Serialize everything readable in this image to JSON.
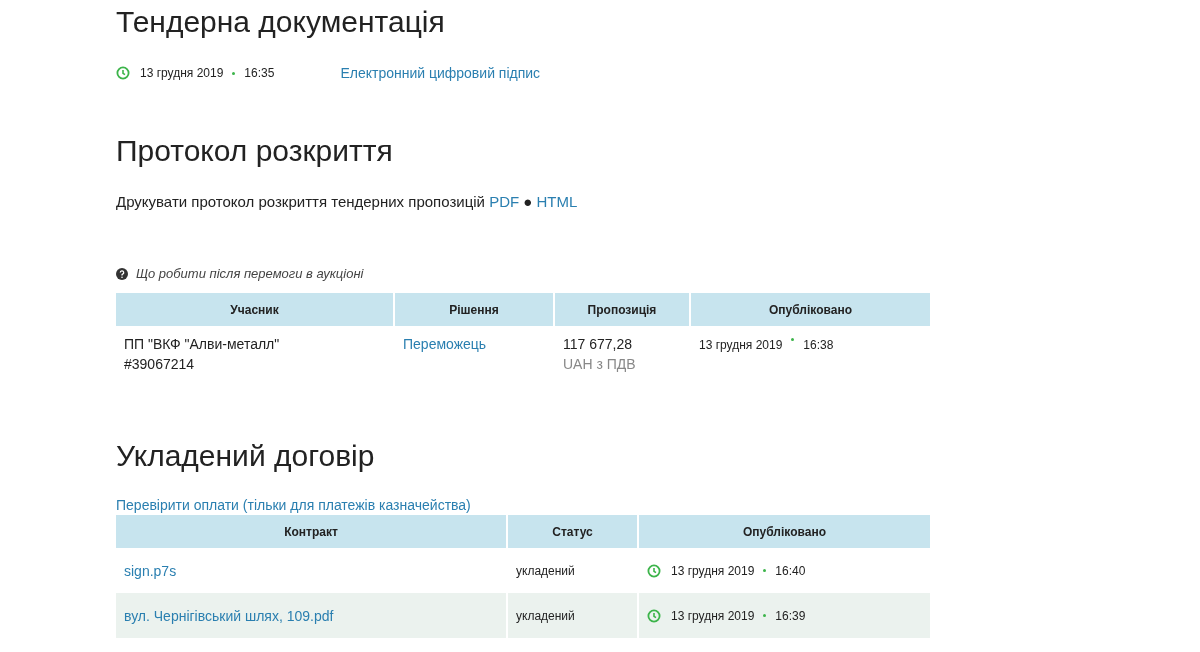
{
  "tender_docs": {
    "title": "Тендерна документація",
    "date": "13 грудня 2019",
    "time": "16:35",
    "signature_link": "Електронний цифровий підпис"
  },
  "protocol": {
    "title": "Протокол розкриття",
    "print_text": "Друкувати протокол розкриття тендерних пропозицій",
    "pdf_link": "PDF",
    "separator": "●",
    "html_link": "HTML"
  },
  "help_link": "Що робити після перемоги в аукціоні",
  "bids_table": {
    "columns": [
      "Учасник",
      "Рішення",
      "Пропозиція",
      "Опубліковано"
    ],
    "rows": [
      {
        "participant": "ПП \"ВКФ \"Алви-металл\"",
        "participant_id": "#39067214",
        "decision": "Переможець",
        "amount": "117 677,28",
        "currency": "UAH з ПДВ",
        "date": "13 грудня 2019",
        "time": "16:38"
      }
    ]
  },
  "contract": {
    "title": "Укладений договір",
    "payments_link": "Перевірити оплати (тільки для платежів казначейства)",
    "columns": [
      "Контракт",
      "Статус",
      "Опубліковано"
    ],
    "rows": [
      {
        "file": "sign.p7s",
        "status": "укладений",
        "date": "13 грудня 2019",
        "time": "16:40"
      },
      {
        "file": "вул. Чернігівський шлях, 109.pdf",
        "status": "укладений",
        "date": "13 грудня 2019",
        "time": "16:39"
      }
    ]
  }
}
